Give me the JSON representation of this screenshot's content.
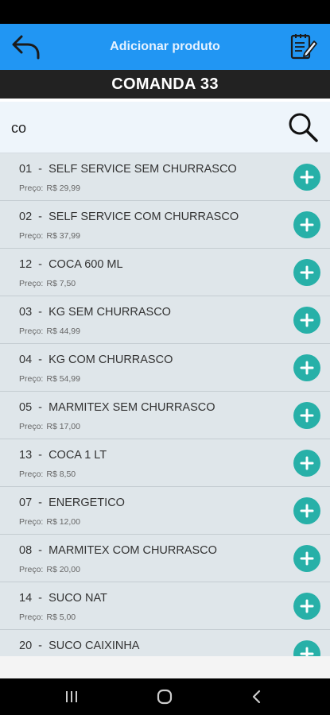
{
  "header": {
    "title": "Adicionar produto",
    "back_icon": "back-arrow-icon",
    "notes_icon": "notepad-pencil-icon"
  },
  "comanda": {
    "label": "COMANDA 33"
  },
  "search": {
    "value": "co",
    "icon": "search-icon"
  },
  "price_label": "Preço:",
  "products": [
    {
      "title": "01  -  SELF SERVICE SEM CHURRASCO",
      "price": "R$ 29,99"
    },
    {
      "title": "02  -  SELF SERVICE COM CHURRASCO",
      "price": "R$ 37,99"
    },
    {
      "title": "12  -  COCA 600 ML",
      "price": "R$ 7,50"
    },
    {
      "title": "03  -  KG SEM CHURRASCO",
      "price": "R$ 44,99"
    },
    {
      "title": "04  -  KG COM CHURRASCO",
      "price": "R$ 54,99"
    },
    {
      "title": "05  -  MARMITEX SEM CHURRASCO",
      "price": "R$ 17,00"
    },
    {
      "title": "13  -  COCA 1 LT",
      "price": "R$ 8,50"
    },
    {
      "title": "07  -  ENERGETICO",
      "price": "R$ 12,00"
    },
    {
      "title": "08  -  MARMITEX COM CHURRASCO",
      "price": "R$ 20,00"
    },
    {
      "title": "14  -  SUCO NAT",
      "price": "R$ 5,00"
    },
    {
      "title": "20  -  SUCO CAIXINHA",
      "price": ""
    }
  ],
  "colors": {
    "header": "#2196f3",
    "add_button": "#27b0a8",
    "list_bg": "#dfe6ea"
  }
}
